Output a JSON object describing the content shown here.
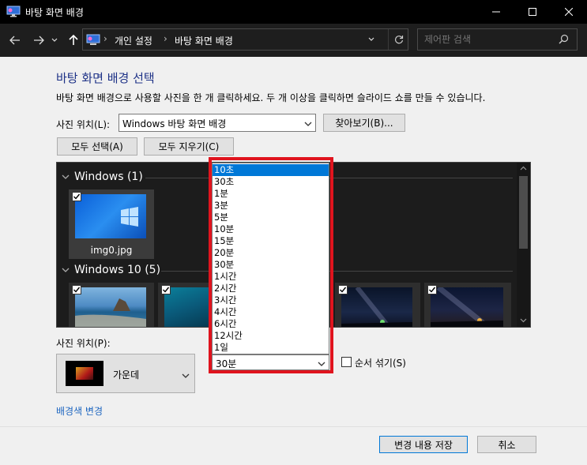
{
  "window": {
    "title": "바탕 화면 배경"
  },
  "nav": {
    "breadcrumb": [
      "개인 설정",
      "바탕 화면 배경"
    ],
    "search_placeholder": "제어판 검색"
  },
  "content": {
    "heading": "바탕 화면 배경 선택",
    "description": "바탕 화면 배경으로 사용할 사진을 한 개 클릭하세요. 두 개 이상을 클릭하면 슬라이드 쇼를 만들 수 있습니다.",
    "picture_location_label": "사진 위치(L):",
    "picture_location_value": "Windows 바탕 화면 배경",
    "browse_button": "찾아보기(B)...",
    "select_all_button": "모두 선택(A)",
    "clear_all_button": "모두 지우기(C)"
  },
  "gallery": {
    "groups": [
      {
        "title": "Windows (1)",
        "items": [
          {
            "label": "img0.jpg",
            "checked": true
          }
        ]
      },
      {
        "title": "Windows 10 (5)",
        "items": [
          {
            "checked": true
          },
          {
            "checked": true
          },
          {
            "checked": true
          },
          {
            "checked": true
          },
          {
            "checked": true
          }
        ]
      }
    ]
  },
  "interval": {
    "options": [
      "10초",
      "30초",
      "1분",
      "3분",
      "5분",
      "10분",
      "15분",
      "20분",
      "30분",
      "1시간",
      "2시간",
      "3시간",
      "4시간",
      "6시간",
      "12시간",
      "1일"
    ],
    "highlighted": "10초",
    "selected": "30분"
  },
  "position": {
    "label": "사진 위치(P):",
    "value": "가운데"
  },
  "shuffle": {
    "label": "순서 섞기(S)",
    "checked": false
  },
  "change_color_link": "배경색 변경",
  "footer": {
    "save_button": "변경 내용 저장",
    "cancel_button": "취소"
  },
  "colors": {
    "accent": "#0078d7",
    "highlight_frame": "#e0141e",
    "heading": "#1e3287",
    "link": "#1e66c0"
  }
}
